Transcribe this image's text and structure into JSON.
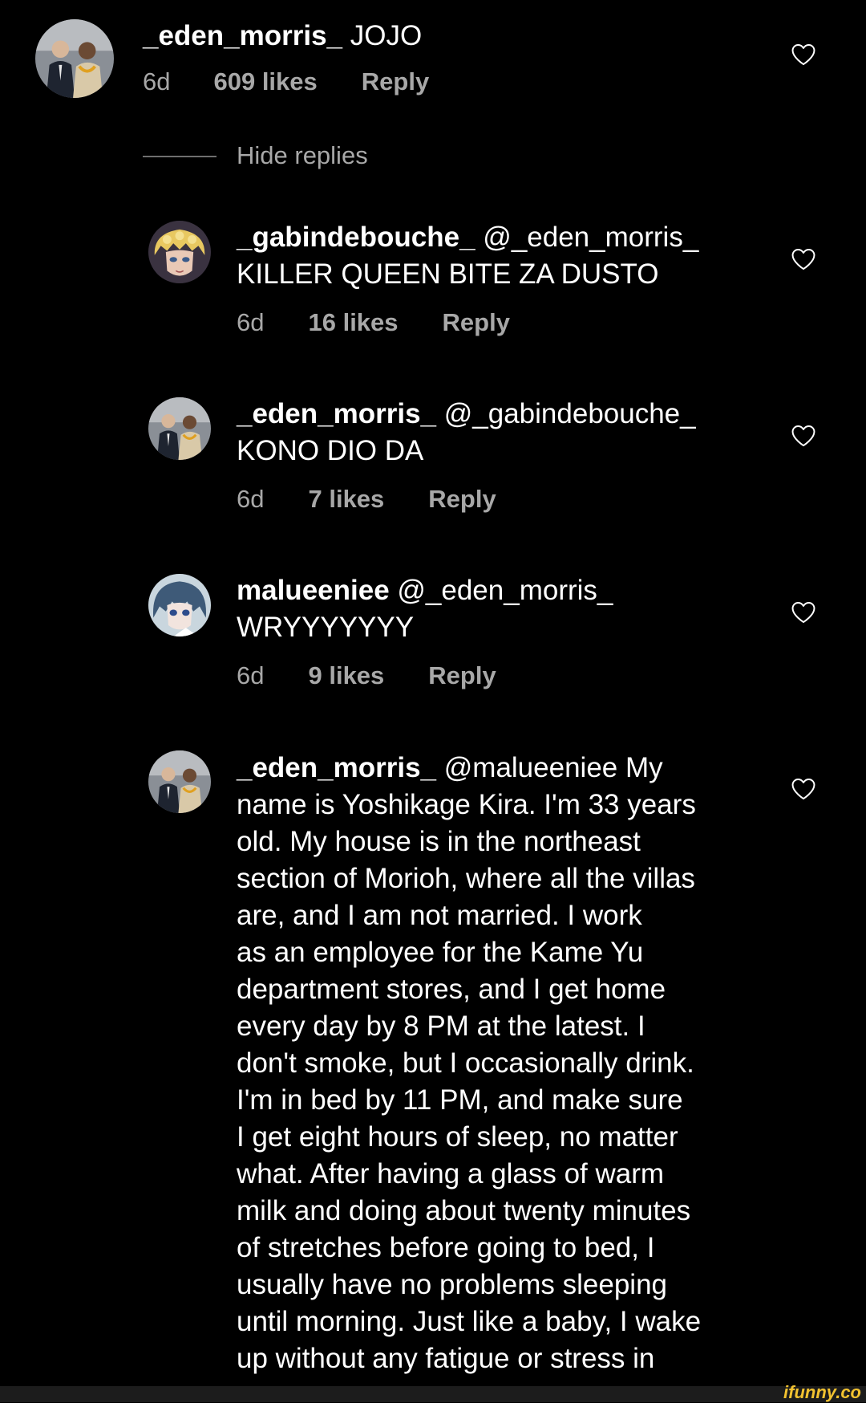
{
  "colors": {
    "background": "#000000",
    "text": "#ffffff",
    "meta_text": "#a8a8a8",
    "watermark": "#f2c230"
  },
  "comments": [
    {
      "username": "_eden_morris_",
      "text": " JOJO",
      "age": "6d",
      "likes": "609 likes",
      "reply": "Reply",
      "avatar_icon": "profile-photo-two-men"
    },
    {
      "username": "_gabindebouche_",
      "text": " @_eden_morris_\nKILLER QUEEN BITE ZA DUSTO",
      "age": "6d",
      "likes": "16 likes",
      "reply": "Reply",
      "avatar_icon": "profile-anime-blonde"
    },
    {
      "username": "_eden_morris_",
      "text": " @_gabindebouche_\nKONO DIO DA",
      "age": "6d",
      "likes": "7 likes",
      "reply": "Reply",
      "avatar_icon": "profile-photo-two-men"
    },
    {
      "username": "malueeniee",
      "text": " @_eden_morris_\nWRYYYYYYY",
      "age": "6d",
      "likes": "9 likes",
      "reply": "Reply",
      "avatar_icon": "profile-anime-blue-hair"
    },
    {
      "username": "_eden_morris_",
      "text": " @malueeniee My\nname is Yoshikage Kira. I'm 33 years\nold. My house is in the northeast\nsection of Morioh, where all the villas\nare, and I am not married. I work\nas an employee for the Kame Yu\ndepartment stores, and I get home\nevery day by 8 PM at the latest. I\ndon't smoke, but I occasionally drink.\nI'm in bed by 11 PM, and make sure\nI get eight hours of sleep, no matter\nwhat. After having a glass of warm\nmilk and doing about twenty minutes\nof stretches before going to bed, I\nusually have no problems sleeping\nuntil morning. Just like a baby, I wake\nup without any fatigue or stress in",
      "avatar_icon": "profile-photo-two-men"
    }
  ],
  "hide_replies": "Hide replies",
  "heart_icon": "heart-outline-icon",
  "watermark": "ifunny.co"
}
